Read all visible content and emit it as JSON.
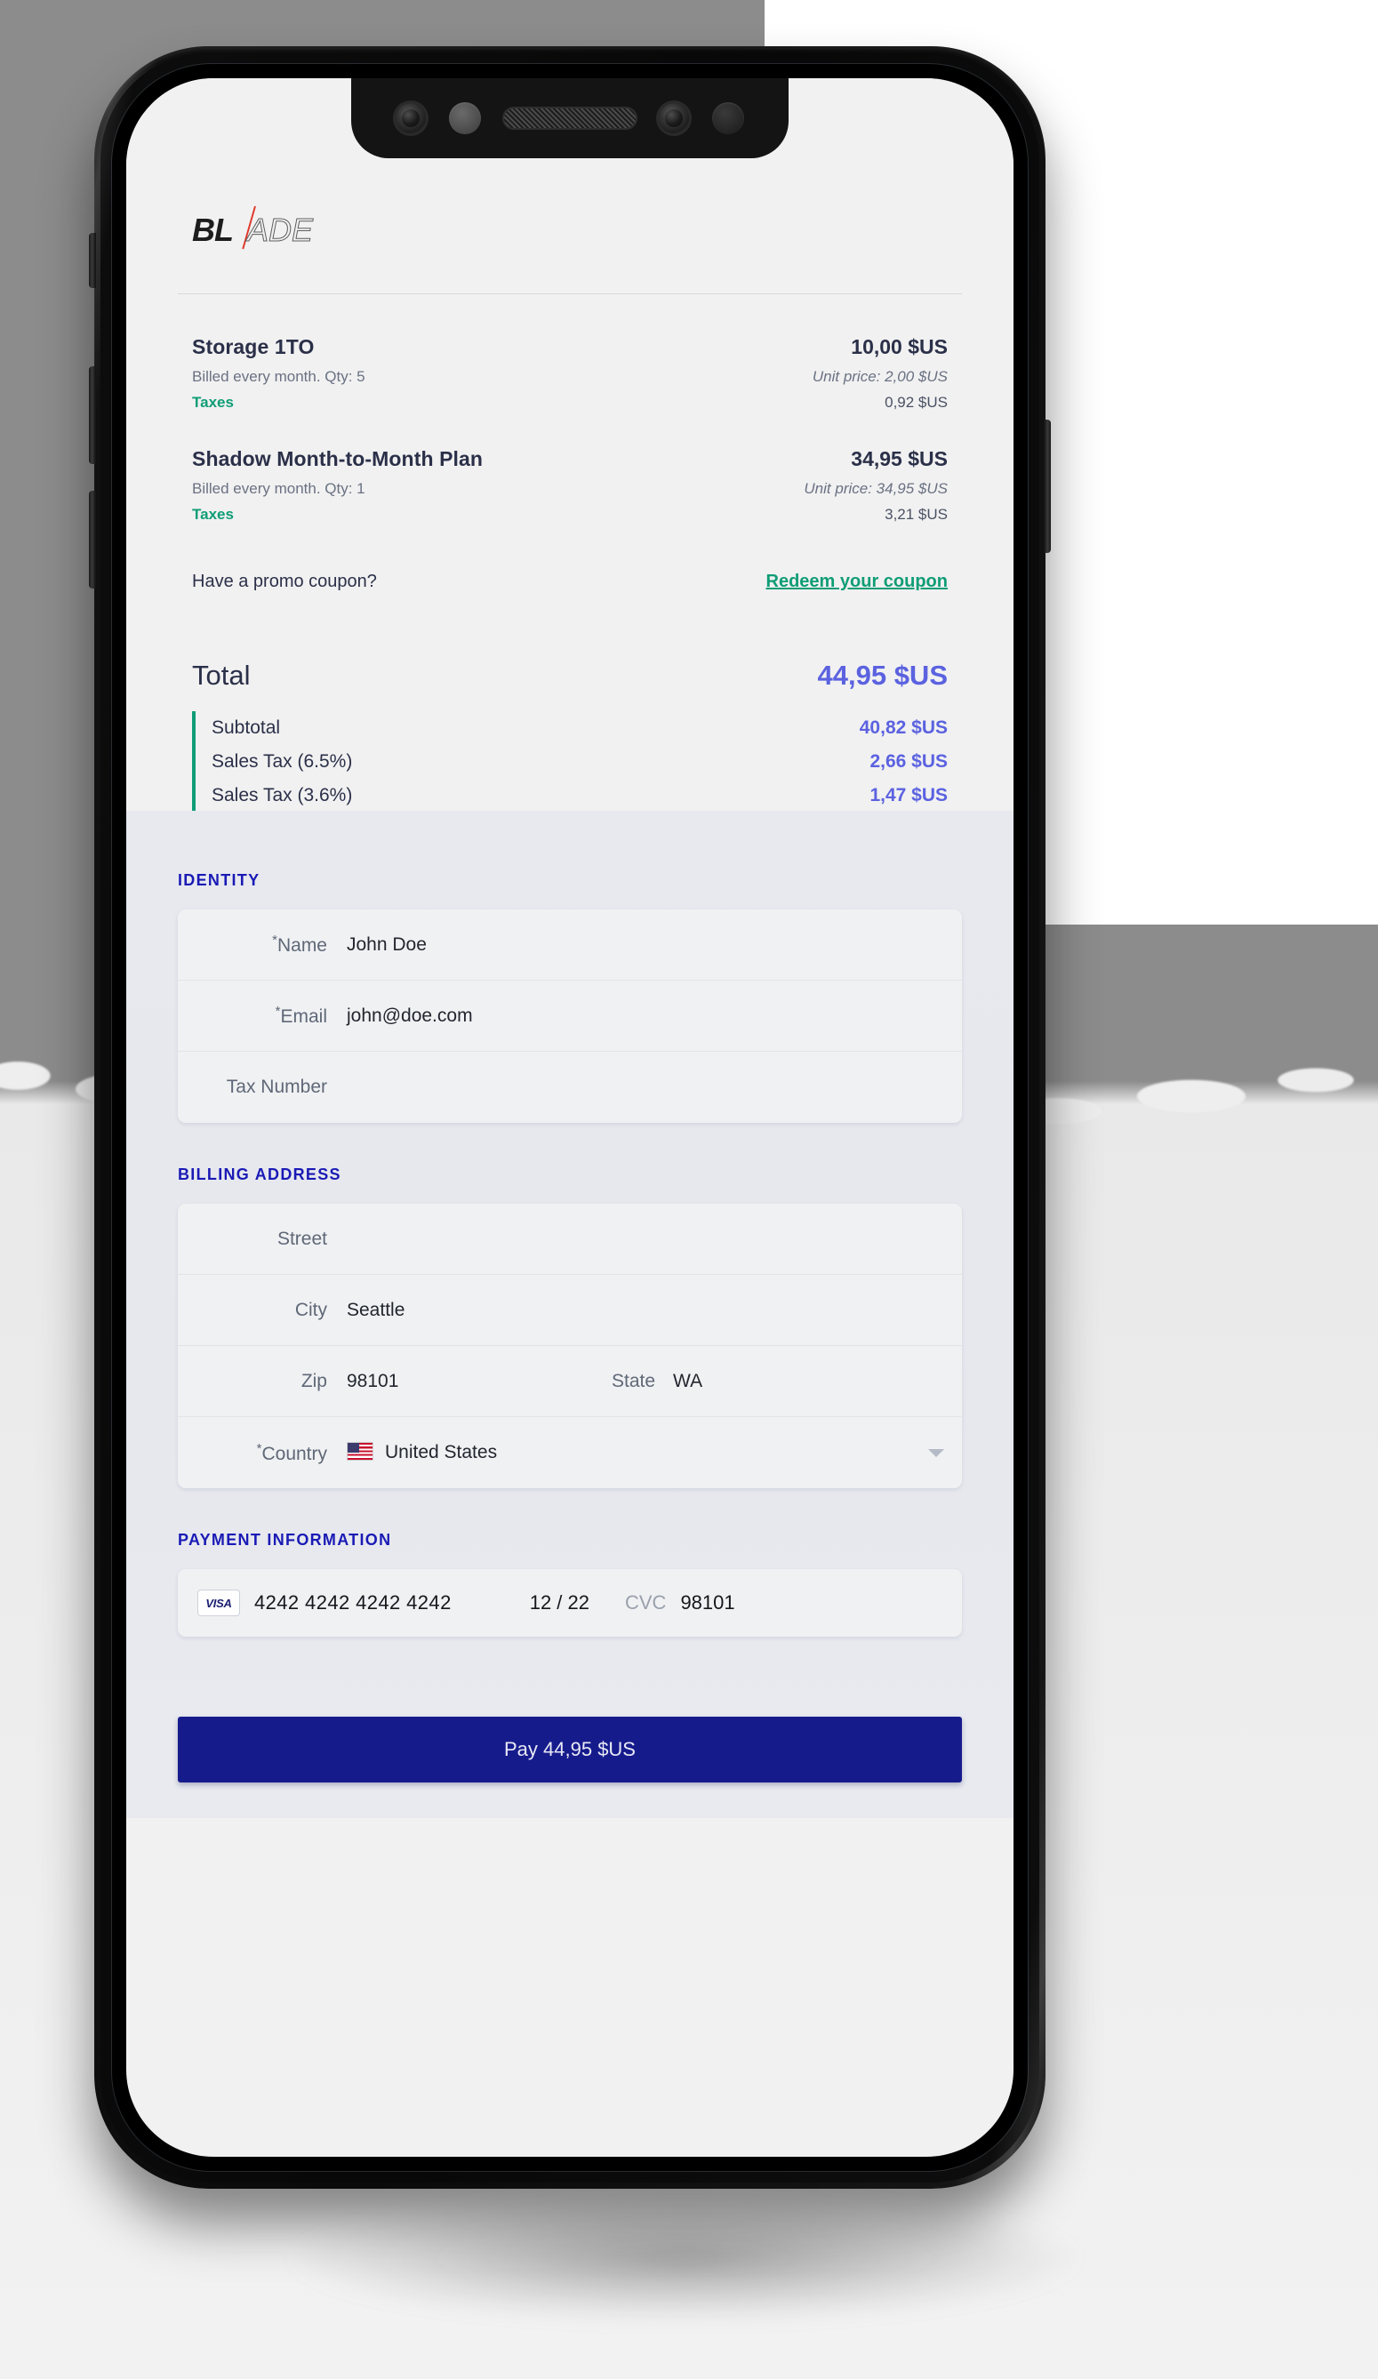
{
  "brand": {
    "logo_bold": "BL",
    "logo_thin": "ADE",
    "accent_red": "#e03b2e",
    "accent_green": "#0f9d76",
    "accent_blue": "#5b62e0",
    "accent_navy": "#161b8c"
  },
  "order": {
    "items": [
      {
        "title": "Storage 1TO",
        "amount": "10,00 $US",
        "billing": "Billed every month. Qty: 5",
        "unit_price": "Unit price: 2,00 $US",
        "tax_label": "Taxes",
        "tax_value": "0,92 $US"
      },
      {
        "title": "Shadow Month-to-Month Plan",
        "amount": "34,95 $US",
        "billing": "Billed every month. Qty: 1",
        "unit_price": "Unit price: 34,95 $US",
        "tax_label": "Taxes",
        "tax_value": "3,21 $US"
      }
    ],
    "coupon_question": "Have a promo coupon?",
    "coupon_link": "Redeem your coupon",
    "total_label": "Total",
    "total_value": "44,95 $US",
    "breakdown": [
      {
        "label": "Subtotal",
        "value": "40,82 $US"
      },
      {
        "label": "Sales Tax (6.5%)",
        "value": "2,66 $US"
      },
      {
        "label": "Sales Tax (3.6%)",
        "value": "1,47 $US"
      }
    ]
  },
  "identity": {
    "section_title": "IDENTITY",
    "name_label": "Name",
    "name_required": "*",
    "name_value": "John Doe",
    "email_label": "Email",
    "email_required": "*",
    "email_value": "john@doe.com",
    "tax_label": "Tax Number",
    "tax_value": ""
  },
  "billing": {
    "section_title": "BILLING ADDRESS",
    "street_label": "Street",
    "street_value": "",
    "city_label": "City",
    "city_value": "Seattle",
    "zip_label": "Zip",
    "zip_value": "98101",
    "state_label": "State",
    "state_value": "WA",
    "country_label": "Country",
    "country_required": "*",
    "country_value": "United States",
    "country_flag": "us-flag-icon"
  },
  "payment": {
    "section_title": "PAYMENT INFORMATION",
    "brand_icon": "visa-logo-icon",
    "brand_label": "VISA",
    "card_number": "4242 4242 4242 4242",
    "expiry": "12 / 22",
    "cvc_label": "CVC",
    "cvc_value": "98101",
    "pay_button": "Pay 44,95 $US"
  },
  "device": {
    "notch_items": [
      "front-camera-icon",
      "proximity-sensor-icon",
      "earpiece-speaker-icon",
      "front-camera-icon",
      "ambient-sensor-icon"
    ]
  }
}
